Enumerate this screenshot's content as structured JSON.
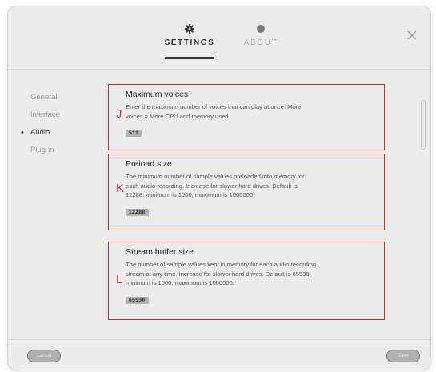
{
  "tabs": {
    "settings": {
      "label": "SETTINGS",
      "icon": "gear-icon",
      "active": true
    },
    "about": {
      "label": "ABOUT",
      "icon": "info-icon",
      "active": false
    }
  },
  "close_icon": "close-icon",
  "sidebar": {
    "items": [
      {
        "label": "General",
        "active": false
      },
      {
        "label": "Interface",
        "active": false
      },
      {
        "label": "Audio",
        "active": true
      },
      {
        "label": "Plug-in",
        "active": false
      }
    ]
  },
  "sections": [
    {
      "title": "Maximum voices",
      "description": "Enter the maximum number of voices that can play at once. More voices = More CPU and memory used.",
      "value": "512",
      "callout": "J"
    },
    {
      "title": "Preload size",
      "description": "The minimum number of sample values preloaded into memory for each audio recording. Increase for slower hard drives. Default is 12288, minimum is 1000, maximum is 1000000.",
      "value": "12288",
      "callout": "K"
    },
    {
      "title": "Stream buffer size",
      "description": "The number of sample values kept in memory for each audio recording stream at any time. Increase for slower hard drives. Default is 65536, minimum is 1000, maximum is 1000000.",
      "value": "65536",
      "callout": "L"
    }
  ],
  "footer": {
    "cancel_label": "Cancel",
    "save_label": "Save"
  },
  "colors": {
    "annotation": "#d22b2b",
    "dialog_bg": "#ececec",
    "active_text": "#333333",
    "inactive_text": "#9a9a9a"
  }
}
